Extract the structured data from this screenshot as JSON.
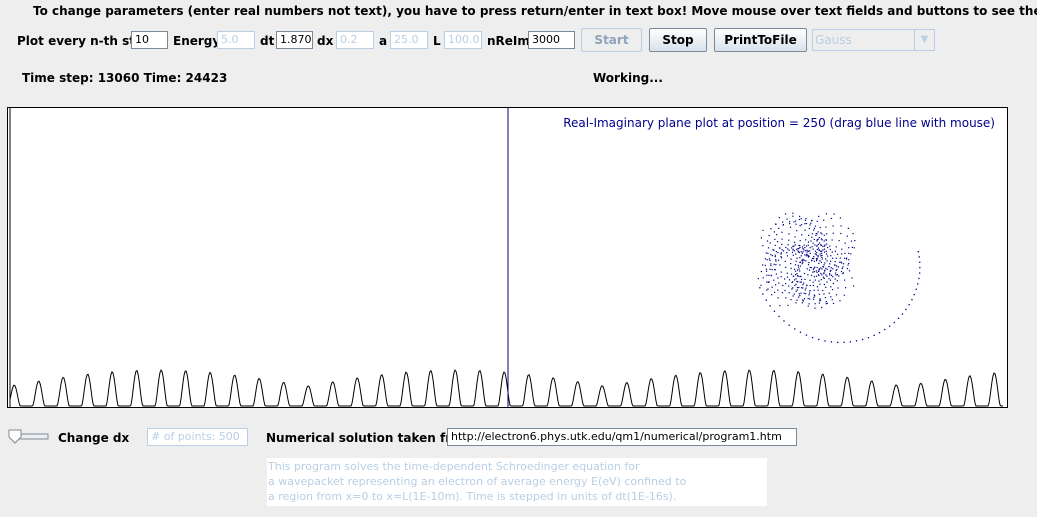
{
  "instruction": "To change parameters (enter real numbers not text), you have to press return/enter in text box! Move mouse over text fields and buttons to see the tip.",
  "controls": {
    "plot_every_label": "Plot every n-th step",
    "plot_every_value": "10",
    "energy_label": "Energy",
    "energy_value": "5.0",
    "dt_label": "dt",
    "dt_value": "1.870(",
    "dx_label": "dx",
    "dx_value": "0.2",
    "a_label": "a",
    "a_value": "25.0",
    "L_label": "L",
    "L_value": "100.0",
    "nreim_label": "nReIm",
    "nreim_value": "3000",
    "start_label": "Start",
    "stop_label": "Stop",
    "print_label": "PrintToFile",
    "combo_value": "Gauss"
  },
  "status": {
    "time_step": "Time step: 13060  Time: 24423",
    "working": "Working..."
  },
  "plot": {
    "annotation": "Real-Imaginary plane plot at position = 250 (drag blue line with mouse)",
    "line_color": "#000000",
    "scatter_color": "#00008b"
  },
  "bottom": {
    "change_dx_label": "Change dx",
    "points_placeholder": "# of points: 500",
    "solution_label": "Numerical solution taken from:",
    "solution_url": "http://electron6.phys.utk.edu/qm1/numerical/program1.htm",
    "info_lines": [
      "This program solves the time-dependent Schroedinger equation for",
      "a wavepacket representing an electron of average energy E(eV) confined to",
      "a region from x=0 to x=L(1E-10m).  Time is stepped in units of dt(1E-16s)."
    ]
  }
}
